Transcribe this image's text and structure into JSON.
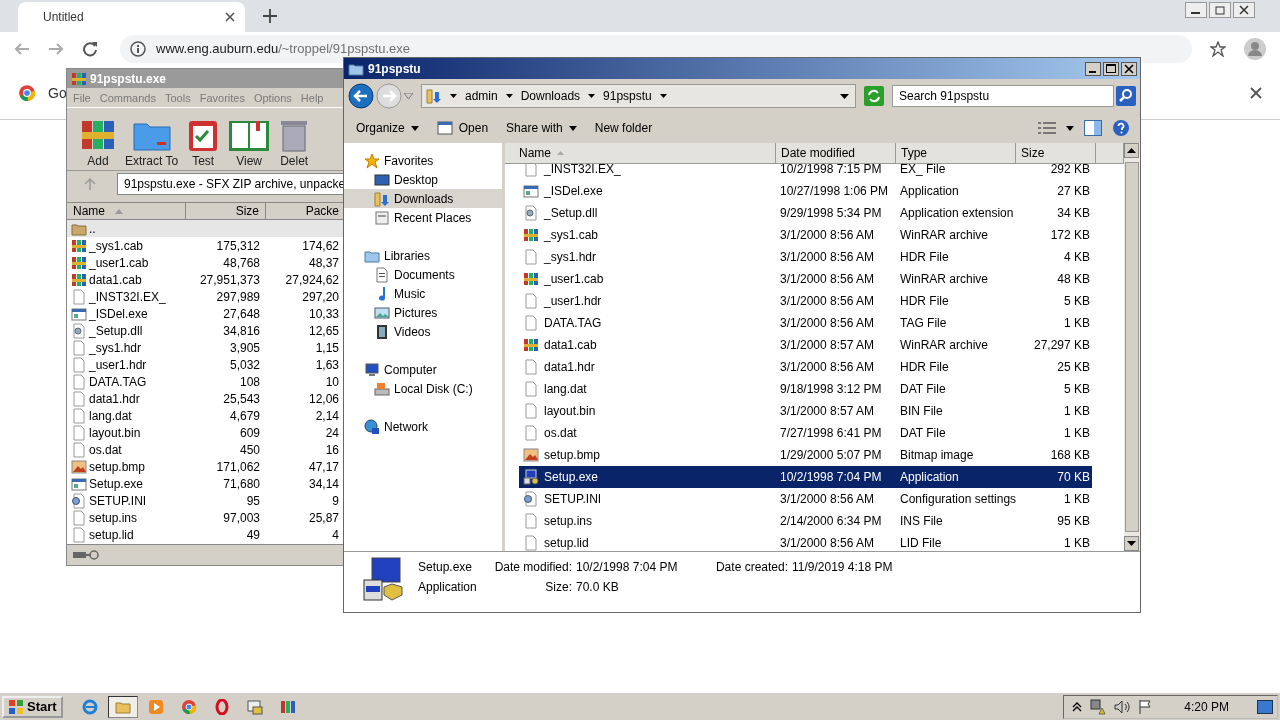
{
  "browser": {
    "tab": {
      "title": "Untitled"
    },
    "url": {
      "host": "www.eng.auburn.edu",
      "path": "/~troppel/91pspstu.exe"
    },
    "infobar": {
      "text": "Go"
    }
  },
  "winrar": {
    "title": "91pspstu.exe",
    "menu": [
      "File",
      "Commands",
      "Tools",
      "Favorites",
      "Options",
      "Help"
    ],
    "tools": [
      {
        "label": "Add",
        "kind": "add"
      },
      {
        "label": "Extract To",
        "kind": "extract"
      },
      {
        "label": "Test",
        "kind": "test"
      },
      {
        "label": "View",
        "kind": "view"
      },
      {
        "label": "Delet",
        "kind": "delete"
      }
    ],
    "path": "91pspstu.exe - SFX ZIP archive, unpacke",
    "columns": [
      "Name",
      "Size",
      "Packe"
    ],
    "rows": [
      {
        "name": "..",
        "kind": "up"
      },
      {
        "name": "_sys1.cab",
        "size": "175,312",
        "packed": "174,62",
        "kind": "rar"
      },
      {
        "name": "_user1.cab",
        "size": "48,768",
        "packed": "48,37",
        "kind": "rar"
      },
      {
        "name": "data1.cab",
        "size": "27,951,373",
        "packed": "27,924,62",
        "kind": "rar"
      },
      {
        "name": "_INST32I.EX_",
        "size": "297,989",
        "packed": "297,20",
        "kind": "blank"
      },
      {
        "name": "_ISDel.exe",
        "size": "27,648",
        "packed": "10,33",
        "kind": "exe"
      },
      {
        "name": "_Setup.dll",
        "size": "34,816",
        "packed": "12,65",
        "kind": "dll"
      },
      {
        "name": "_sys1.hdr",
        "size": "3,905",
        "packed": "1,15",
        "kind": "blank"
      },
      {
        "name": "_user1.hdr",
        "size": "5,032",
        "packed": "1,63",
        "kind": "blank"
      },
      {
        "name": "DATA.TAG",
        "size": "108",
        "packed": "10",
        "kind": "blank"
      },
      {
        "name": "data1.hdr",
        "size": "25,543",
        "packed": "12,06",
        "kind": "blank"
      },
      {
        "name": "lang.dat",
        "size": "4,679",
        "packed": "2,14",
        "kind": "blank"
      },
      {
        "name": "layout.bin",
        "size": "609",
        "packed": "24",
        "kind": "blank"
      },
      {
        "name": "os.dat",
        "size": "450",
        "packed": "16",
        "kind": "blank"
      },
      {
        "name": "setup.bmp",
        "size": "171,062",
        "packed": "47,17",
        "kind": "bmp"
      },
      {
        "name": "Setup.exe",
        "size": "71,680",
        "packed": "34,14",
        "kind": "exe"
      },
      {
        "name": "SETUP.INI",
        "size": "95",
        "packed": "9",
        "kind": "ini"
      },
      {
        "name": "setup.ins",
        "size": "97,003",
        "packed": "25,87",
        "kind": "blank"
      },
      {
        "name": "setup.lid",
        "size": "49",
        "packed": "4",
        "kind": "blank"
      }
    ]
  },
  "explorer": {
    "title": "91pspstu",
    "breadcrumb": [
      "admin",
      "Downloads",
      "91pspstu"
    ],
    "search": {
      "placeholder": "Search 91pspstu"
    },
    "toolbar": [
      {
        "label": "Organize",
        "kind": "menu"
      },
      {
        "label": "Open",
        "kind": "open"
      },
      {
        "label": "Share with",
        "kind": "menu"
      },
      {
        "label": "New folder",
        "kind": "plain"
      }
    ],
    "nav": [
      {
        "label": "Favorites",
        "kind": "star",
        "selected": false,
        "children": [
          {
            "label": "Desktop",
            "kind": "desktop",
            "selected": false
          },
          {
            "label": "Downloads",
            "kind": "downloads",
            "selected": true
          },
          {
            "label": "Recent Places",
            "kind": "recent",
            "selected": false
          }
        ]
      },
      {
        "label": "Libraries",
        "kind": "libraries",
        "selected": false,
        "children": [
          {
            "label": "Documents",
            "kind": "documents",
            "selected": false
          },
          {
            "label": "Music",
            "kind": "music",
            "selected": false
          },
          {
            "label": "Pictures",
            "kind": "pictures",
            "selected": false
          },
          {
            "label": "Videos",
            "kind": "videos",
            "selected": false
          }
        ]
      },
      {
        "label": "Computer",
        "kind": "computer",
        "selected": false,
        "children": [
          {
            "label": "Local Disk (C:)",
            "kind": "disk",
            "selected": false
          }
        ]
      },
      {
        "label": "Network",
        "kind": "network",
        "selected": false
      }
    ],
    "columns": [
      "Name",
      "Date modified",
      "Type",
      "Size"
    ],
    "rows": [
      {
        "name": "_INST32I.EX_",
        "date": "10/2/1998 7:15 PM",
        "type": "EX_ File",
        "size": "292 KB",
        "kind": "blank",
        "selected": false
      },
      {
        "name": "_ISDel.exe",
        "date": "10/27/1998 1:06 PM",
        "type": "Application",
        "size": "27 KB",
        "kind": "exe",
        "selected": false
      },
      {
        "name": "_Setup.dll",
        "date": "9/29/1998 5:34 PM",
        "type": "Application extension",
        "size": "34 KB",
        "kind": "dll",
        "selected": false
      },
      {
        "name": "_sys1.cab",
        "date": "3/1/2000 8:56 AM",
        "type": "WinRAR archive",
        "size": "172 KB",
        "kind": "rar",
        "selected": false
      },
      {
        "name": "_sys1.hdr",
        "date": "3/1/2000 8:56 AM",
        "type": "HDR File",
        "size": "4 KB",
        "kind": "blank",
        "selected": false
      },
      {
        "name": "_user1.cab",
        "date": "3/1/2000 8:56 AM",
        "type": "WinRAR archive",
        "size": "48 KB",
        "kind": "rar",
        "selected": false
      },
      {
        "name": "_user1.hdr",
        "date": "3/1/2000 8:56 AM",
        "type": "HDR File",
        "size": "5 KB",
        "kind": "blank",
        "selected": false
      },
      {
        "name": "DATA.TAG",
        "date": "3/1/2000 8:56 AM",
        "type": "TAG File",
        "size": "1 KB",
        "kind": "blank",
        "selected": false
      },
      {
        "name": "data1.cab",
        "date": "3/1/2000 8:57 AM",
        "type": "WinRAR archive",
        "size": "27,297 KB",
        "kind": "rar",
        "selected": false
      },
      {
        "name": "data1.hdr",
        "date": "3/1/2000 8:56 AM",
        "type": "HDR File",
        "size": "25 KB",
        "kind": "blank",
        "selected": false
      },
      {
        "name": "lang.dat",
        "date": "9/18/1998 3:12 PM",
        "type": "DAT File",
        "size": "5 KB",
        "kind": "blank",
        "selected": false
      },
      {
        "name": "layout.bin",
        "date": "3/1/2000 8:57 AM",
        "type": "BIN File",
        "size": "1 KB",
        "kind": "blank",
        "selected": false
      },
      {
        "name": "os.dat",
        "date": "7/27/1998 6:41 PM",
        "type": "DAT File",
        "size": "1 KB",
        "kind": "blank",
        "selected": false
      },
      {
        "name": "setup.bmp",
        "date": "1/29/2000 5:07 PM",
        "type": "Bitmap image",
        "size": "168 KB",
        "kind": "bmp",
        "selected": false
      },
      {
        "name": "Setup.exe",
        "date": "10/2/1998 7:04 PM",
        "type": "Application",
        "size": "70 KB",
        "kind": "setup",
        "selected": true
      },
      {
        "name": "SETUP.INI",
        "date": "3/1/2000 8:56 AM",
        "type": "Configuration settings",
        "size": "1 KB",
        "kind": "ini",
        "selected": false
      },
      {
        "name": "setup.ins",
        "date": "2/14/2000 6:34 PM",
        "type": "INS File",
        "size": "95 KB",
        "kind": "blank",
        "selected": false
      },
      {
        "name": "setup.lid",
        "date": "3/1/2000 8:56 AM",
        "type": "LID File",
        "size": "1 KB",
        "kind": "blank",
        "selected": false
      }
    ],
    "details": {
      "name": "Setup.exe",
      "type": "Application",
      "modified_label": "Date modified:",
      "modified": "10/2/1998 7:04 PM",
      "created_label": "Date created:",
      "created": "11/9/2019 4:18 PM",
      "size_label": "Size:",
      "size": "70.0 KB"
    }
  },
  "taskbar": {
    "start": "Start",
    "apps": [
      {
        "kind": "ie",
        "selected": false
      },
      {
        "kind": "explorer",
        "selected": true
      },
      {
        "kind": "media",
        "selected": false
      },
      {
        "kind": "chrome",
        "selected": false
      },
      {
        "kind": "opera",
        "selected": false
      },
      {
        "kind": "program",
        "selected": false
      },
      {
        "kind": "winrar",
        "selected": false
      }
    ],
    "clock": "4:20 PM"
  }
}
